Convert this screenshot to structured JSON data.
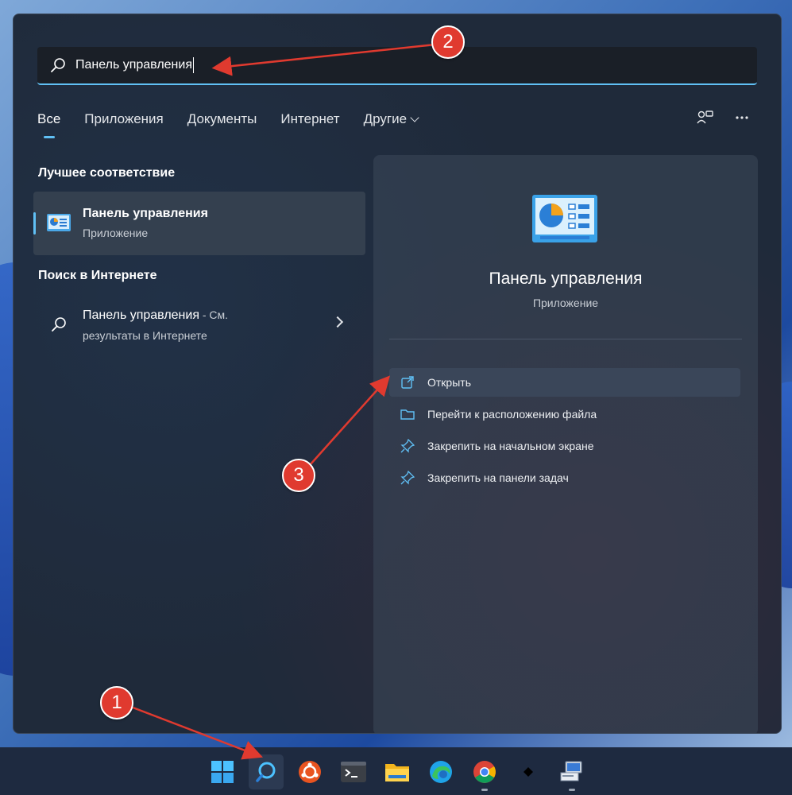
{
  "search": {
    "query": "Панель управления"
  },
  "tabs": [
    {
      "label": "Все"
    },
    {
      "label": "Приложения"
    },
    {
      "label": "Документы"
    },
    {
      "label": "Интернет"
    },
    {
      "label": "Другие"
    }
  ],
  "sections": {
    "best_match": "Лучшее соответствие",
    "web_search": "Поиск в Интернете"
  },
  "best_match_item": {
    "title": "Панель управления",
    "subtitle": "Приложение"
  },
  "web_item": {
    "title": "Панель управления",
    "suffix": " - См.",
    "subtitle": "результаты в Интернете"
  },
  "details": {
    "title": "Панель управления",
    "subtitle": "Приложение",
    "actions": [
      {
        "label": "Открыть",
        "icon": "open-external-icon"
      },
      {
        "label": "Перейти к расположению файла",
        "icon": "folder-icon"
      },
      {
        "label": "Закрепить на начальном экране",
        "icon": "pin-icon"
      },
      {
        "label": "Закрепить на панели задач",
        "icon": "pin-icon"
      }
    ]
  },
  "taskbar": {
    "items": [
      {
        "name": "start-icon"
      },
      {
        "name": "search-icon"
      },
      {
        "name": "ubuntu-icon"
      },
      {
        "name": "terminal-icon"
      },
      {
        "name": "file-explorer-icon"
      },
      {
        "name": "edge-icon"
      },
      {
        "name": "chrome-icon"
      },
      {
        "name": "app-diamond-icon"
      },
      {
        "name": "network-computer-icon"
      }
    ]
  },
  "annotations": {
    "one": "1",
    "two": "2",
    "three": "3"
  },
  "colors": {
    "accent": "#60c0f5",
    "annotation": "#e03a2f"
  }
}
